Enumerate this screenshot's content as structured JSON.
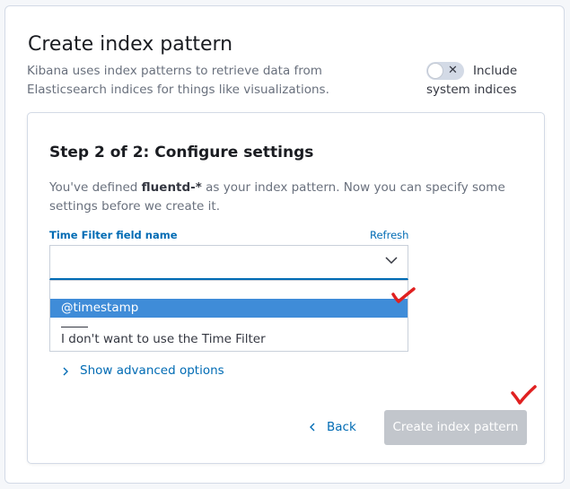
{
  "header": {
    "title": "Create index pattern",
    "subtitle": "Kibana uses index patterns to retrieve data from Elasticsearch indices for things like visualizations."
  },
  "system_indices_toggle": {
    "label": "Include system indices",
    "state": "off",
    "icon": "cross-icon"
  },
  "step": {
    "title": "Step 2 of 2: Configure settings",
    "desc_prefix": "You've defined ",
    "pattern": "fluentd-*",
    "desc_suffix": " as your index pattern. Now you can specify some settings before we create it."
  },
  "time_field": {
    "label": "Time Filter field name",
    "refresh_label": "Refresh",
    "selected_value": "",
    "options": [
      "@timestamp",
      "I don't want to use the Time Filter"
    ],
    "highlighted_option": "@timestamp"
  },
  "advanced_label": "Show advanced options",
  "footer": {
    "back_label": "Back",
    "create_label": "Create index pattern",
    "create_disabled": true
  },
  "colors": {
    "accent": "#006bb4",
    "highlight": "#3f8cd8",
    "disabled_button": "#c2c6cc",
    "annotation_mark": "#e02020"
  }
}
